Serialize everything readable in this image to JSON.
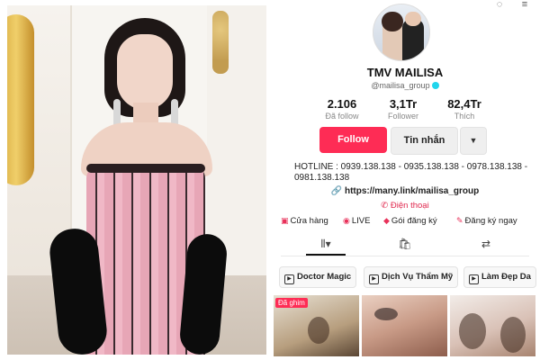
{
  "profile": {
    "display_name": "TMV MAILISA",
    "handle": "@mailisa_group",
    "stats": [
      {
        "value": "2.106",
        "label": "Đã follow"
      },
      {
        "value": "3,1Tr",
        "label": "Follower"
      },
      {
        "value": "82,4Tr",
        "label": "Thích"
      }
    ],
    "buttons": {
      "follow": "Follow",
      "message": "Tin nhắn",
      "more": "▼"
    },
    "bio": "HOTLINE : 0939.138.138 - 0935.138.138 - 0978.138.138 - 0981.138.138",
    "link": "https://many.link/mailisa_group",
    "phone_label": "Điện thoại",
    "shortcuts": [
      {
        "label": "Cửa hàng",
        "icon": "shop-icon"
      },
      {
        "label": "LIVE",
        "icon": "live-icon"
      },
      {
        "label": "Gói đăng ký",
        "icon": "subscription-icon"
      },
      {
        "label": "Đăng ký ngay",
        "icon": "register-icon"
      }
    ],
    "tabs": [
      {
        "glyph": "⦀▾",
        "icon": "videos-grid-icon"
      },
      {
        "glyph": "🛍",
        "icon": "shop-bag-icon"
      },
      {
        "glyph": "⇄",
        "icon": "repost-icon"
      }
    ],
    "playlists": [
      {
        "label": "Doctor Magic"
      },
      {
        "label": "Dịch Vụ Thẩm Mỹ"
      },
      {
        "label": "Làm Đẹp Da"
      }
    ],
    "pinned_label": "Đã ghim",
    "colors": {
      "accent": "#fe2c55",
      "link_red": "#e0284e"
    }
  }
}
